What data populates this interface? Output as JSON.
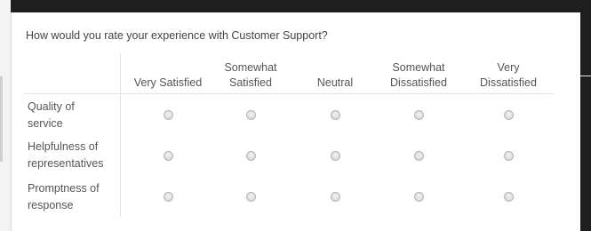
{
  "question": "How would you rate your experience with Customer Support?",
  "columns": [
    "Very Satisfied",
    "Somewhat Satisfied",
    "Neutral",
    "Somewhat Dissatisfied",
    "Very Dissatisfied"
  ],
  "rows": [
    {
      "label_line1": "Quality of",
      "label_line2": "service"
    },
    {
      "label_line1": "Helpfulness of",
      "label_line2": "representatives"
    },
    {
      "label_line1": "Promptness of",
      "label_line2": "response"
    }
  ],
  "selected": [
    null,
    null,
    null
  ]
}
